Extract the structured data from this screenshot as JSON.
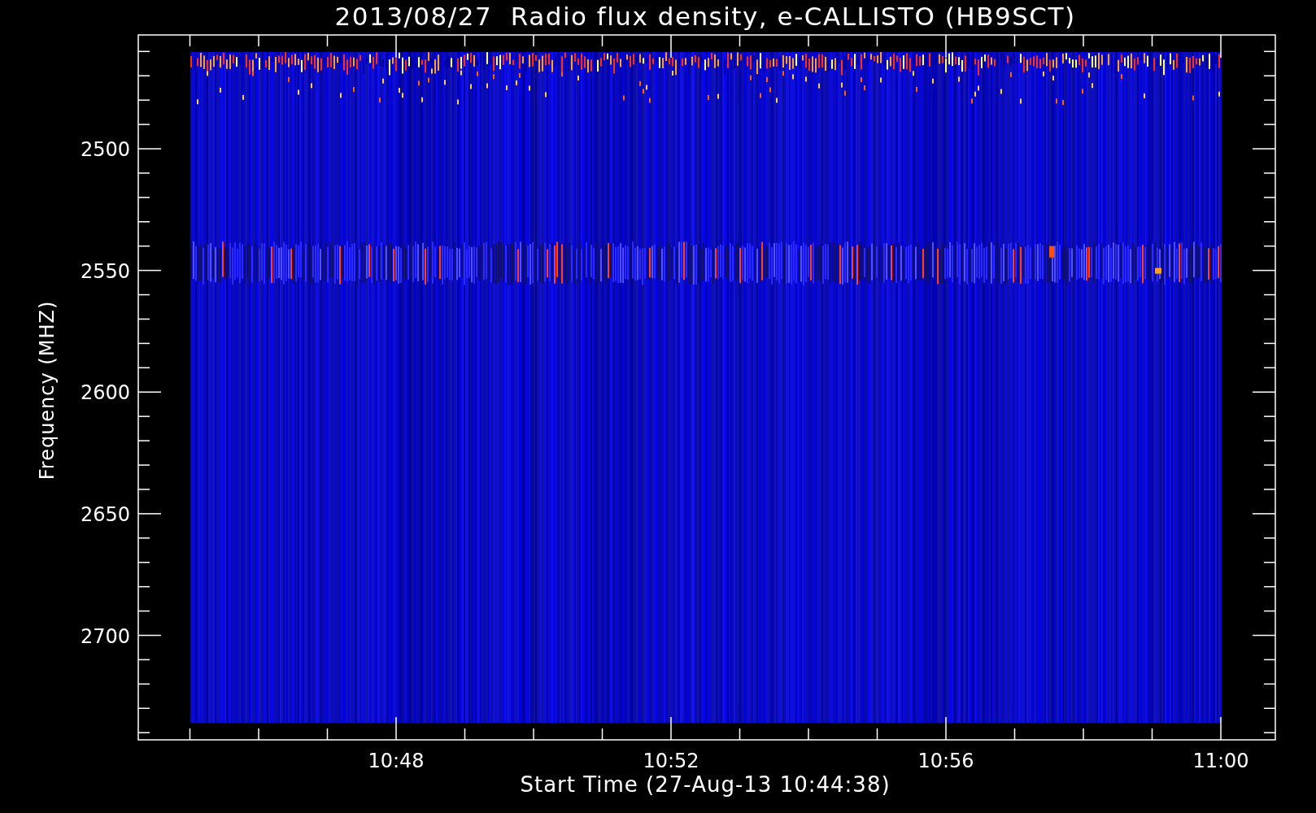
{
  "title": "2013/08/27  Radio flux density, e-CALLISTO (HB9SCT)",
  "plot": {
    "ylabel": "Frequency (MHZ)",
    "xlabel": "Start Time (27-Aug-13 10:44:38)",
    "yticks": [
      {
        "label": "2500"
      },
      {
        "label": "2550"
      },
      {
        "label": "2600"
      },
      {
        "label": "2650"
      },
      {
        "label": "2700"
      }
    ],
    "xticks": [
      {
        "label": "10:48"
      },
      {
        "label": "10:52"
      },
      {
        "label": "10:56"
      },
      {
        "label": "11:00"
      }
    ]
  }
}
